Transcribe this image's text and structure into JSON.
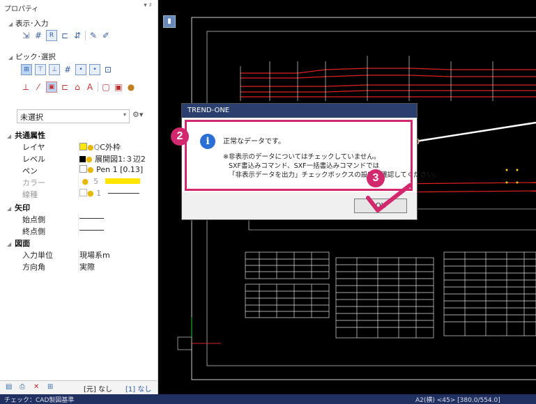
{
  "panel": {
    "title": "プロパティ",
    "pin": "▾ ♯",
    "sections": {
      "display_input": "表示･入力",
      "pick_select": "ピック･選択"
    },
    "filter": {
      "value": "未選択"
    },
    "groups": {
      "common": "共通属性",
      "arrow": "矢印",
      "drawing": "図面"
    },
    "common_rows": [
      {
        "key": "レイヤ",
        "value": "C外枠"
      },
      {
        "key": "レベル",
        "value": "展開図1:３辺2"
      },
      {
        "key": "ペン",
        "value": "Pen 1 [0.13]"
      },
      {
        "key": "カラー",
        "value": "5"
      },
      {
        "key": "線種",
        "value": "1"
      }
    ],
    "arrow_rows": [
      {
        "key": "始点側",
        "value": ""
      },
      {
        "key": "終点側",
        "value": ""
      }
    ],
    "drawing_rows": [
      {
        "key": "入力単位",
        "value": "現場系m"
      },
      {
        "key": "方向角",
        "value": "実際"
      }
    ],
    "footer": {
      "tab1": "[元] なし",
      "tab2": "[1] なし"
    }
  },
  "colors": {
    "accent": "#d2286e",
    "layer_swatch": "#ffe600",
    "color_swatch": "#ffe600",
    "canvas_bg": "#000000"
  },
  "dialog": {
    "title": "TREND-ONE",
    "message": "正常なデータです。",
    "note1": "※非表示のデータについてはチェックしていません。",
    "note2": "SXF書込みコマンド、SXF一括書込みコマンドでは",
    "note3": "「非表示データを出力」チェックボックスの設定を確認してください。",
    "ok_label": "OK"
  },
  "callouts": {
    "step2": "2",
    "step3": "3"
  },
  "statusbar": {
    "left": "チェック：CAD製図基準",
    "right": "A2(横) <45> [380.0/554.0]"
  }
}
